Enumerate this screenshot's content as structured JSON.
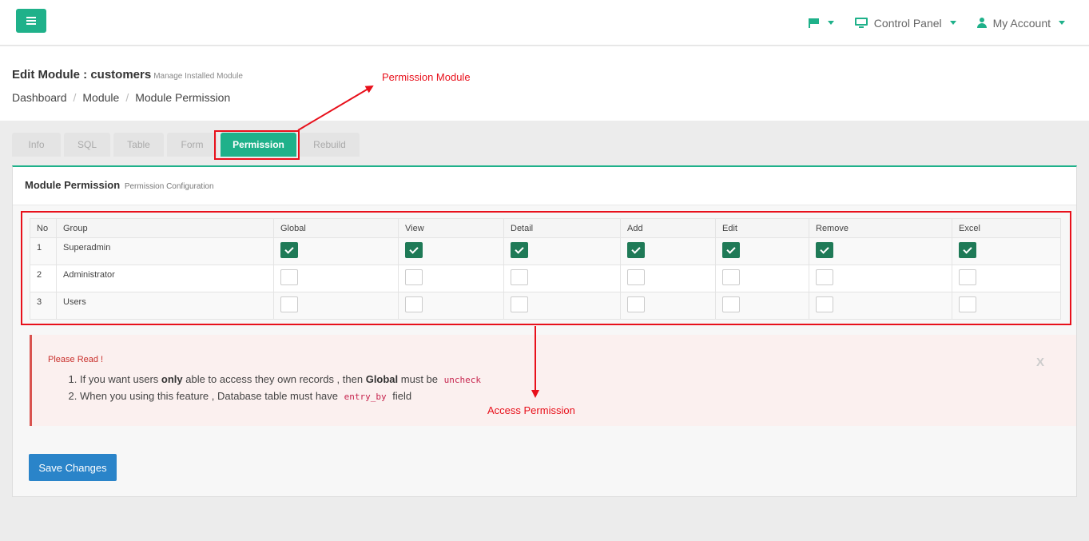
{
  "topbar": {
    "menu_icon": "hamburger-icon",
    "flag_icon": "flag-icon",
    "control_panel": "Control Panel",
    "my_account": "My Account",
    "accent_color": "#1fb18a"
  },
  "header": {
    "title": "Edit Module : customers",
    "subtitle": "Manage Installed Module",
    "breadcrumb": [
      "Dashboard",
      "Module",
      "Module Permission"
    ]
  },
  "tabs": [
    {
      "label": "Info",
      "active": false
    },
    {
      "label": "SQL",
      "active": false
    },
    {
      "label": "Table",
      "active": false
    },
    {
      "label": "Form",
      "active": false
    },
    {
      "label": "Permission",
      "active": true
    },
    {
      "label": "Rebuild",
      "active": false
    }
  ],
  "panel": {
    "title": "Module Permission",
    "subtitle": "Permission Configuration"
  },
  "table": {
    "columns": [
      "No",
      "Group",
      "Global",
      "View",
      "Detail",
      "Add",
      "Edit",
      "Remove",
      "Excel"
    ],
    "rows": [
      {
        "no": "1",
        "group": "Superadmin",
        "checks": [
          true,
          true,
          true,
          true,
          true,
          true,
          true
        ]
      },
      {
        "no": "2",
        "group": "Administrator",
        "checks": [
          false,
          false,
          false,
          false,
          false,
          false,
          false
        ]
      },
      {
        "no": "3",
        "group": "Users",
        "checks": [
          false,
          false,
          false,
          false,
          false,
          false,
          false
        ]
      }
    ]
  },
  "alert": {
    "title": "Please Read !",
    "item1_a": "If you want users ",
    "item1_b": "only",
    "item1_c": " able to access they own records , then ",
    "item1_d": "Global",
    "item1_e": " must be ",
    "item1_code": "uncheck",
    "item2_a": "When you using this feature , Database table must have ",
    "item2_code": "entry_by",
    "item2_b": " field",
    "close": "X"
  },
  "save_button": "Save Changes",
  "annotations": {
    "permission_module": "Permission Module",
    "access_permission": "Access Permission",
    "color": "#e8101b"
  }
}
